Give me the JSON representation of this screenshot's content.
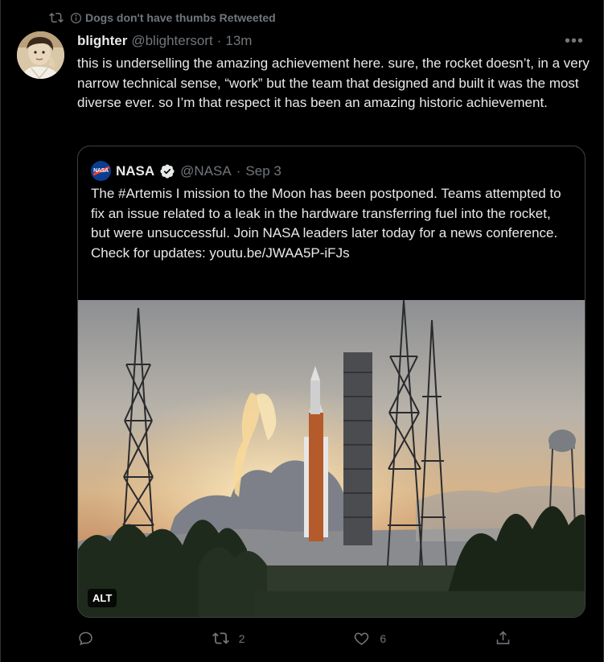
{
  "retweet": {
    "icon": "retweet-icon",
    "text": "Dogs don't have thumbs Retweeted"
  },
  "tweet": {
    "display_name": "blighter",
    "handle": "@blightersort",
    "separator": "·",
    "time": "13m",
    "more_label": "•••",
    "text": "this is underselling the amazing achievement here. sure, the rocket doesn’t, in a very narrow technical sense, “work” but the team that designed and built it was the most diverse ever. so I’m that respect it has been an amazing historic achievement."
  },
  "quote": {
    "logo_text": "NASA",
    "display_name": "NASA",
    "handle": "@NASA",
    "separator": "·",
    "date": "Sep 3",
    "text": "The #Artemis I mission to the Moon has been postponed. Teams attempted to fix an issue related to a leak in the hardware transferring fuel into the rocket, but were unsuccessful. Join NASA leaders later today for a news conference. Check for updates: youtu.be/JWAA5P-iFJs",
    "alt_label": "ALT"
  },
  "actions": {
    "reply_count": "",
    "retweet_count": "2",
    "like_count": "6"
  },
  "colors": {
    "background": "#000000",
    "text": "#e7e9ea",
    "muted": "#71767b",
    "border": "#3e4144",
    "nasa_blue": "#0b3d91",
    "verified": "#e7e9ea"
  }
}
